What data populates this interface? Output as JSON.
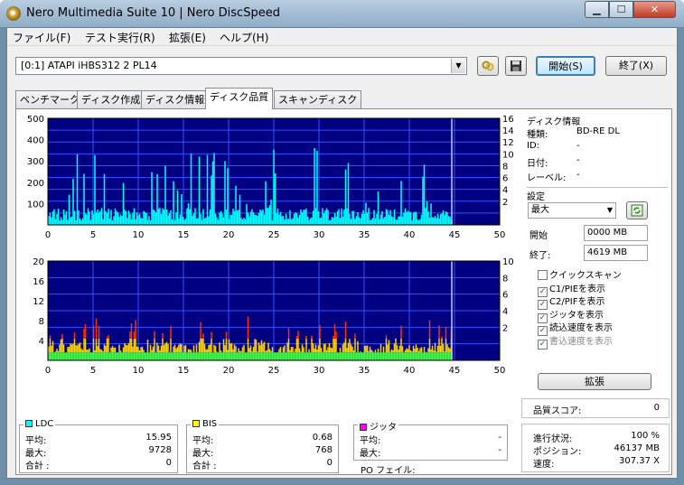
{
  "window": {
    "title": "Nero Multimedia Suite 10 | Nero DiscSpeed"
  },
  "menu": [
    "ファイル(F)",
    "テスト実行(R)",
    "拡張(E)",
    "ヘルプ(H)"
  ],
  "toolbar": {
    "drive": "[0:1]   ATAPI iHBS312   2 PL14",
    "start_label": "開始(S)",
    "exit_label": "終了(X)"
  },
  "tabs": [
    "ベンチマーク",
    "ディスク作成",
    "ディスク情報",
    "ディスク品質",
    "スキャンディスク"
  ],
  "active_tab": 3,
  "chart_data": [
    {
      "type": "bar",
      "x_ticks": [
        "0",
        "5",
        "10",
        "15",
        "20",
        "25",
        "30",
        "35",
        "40",
        "45",
        "50"
      ],
      "y_left_ticks": [
        "500",
        "400",
        "300",
        "200",
        "100"
      ],
      "y_right_ticks": [
        "16",
        "14",
        "12",
        "10",
        "8",
        "6",
        "4",
        "2"
      ],
      "ylim": [
        0,
        500
      ],
      "xlim": [
        0,
        50
      ],
      "series": [
        {
          "name": "LDC",
          "color": "#00ffff"
        }
      ],
      "data_end_x": 44.7
    },
    {
      "type": "bar",
      "x_ticks": [
        "0",
        "5",
        "10",
        "15",
        "20",
        "25",
        "30",
        "35",
        "40",
        "45",
        "50"
      ],
      "y_left_ticks": [
        "20",
        "16",
        "12",
        "8",
        "4"
      ],
      "y_right_ticks": [
        "10",
        "8",
        "6",
        "4",
        "2"
      ],
      "ylim": [
        0,
        20
      ],
      "xlim": [
        0,
        50
      ],
      "series": [
        {
          "name": "BIS",
          "color": "#ffff00"
        }
      ],
      "data_end_x": 44.7
    }
  ],
  "stats": {
    "ldc": {
      "label": "LDC",
      "color": "#00ffff",
      "avg_label": "平均:",
      "avg": "15.95",
      "max_label": "最大:",
      "max": "9728",
      "total_label": "合計 :",
      "total": "0"
    },
    "bis": {
      "label": "BIS",
      "color": "#ffff00",
      "avg_label": "平均:",
      "avg": "0.68",
      "max_label": "最大:",
      "max": "768",
      "total_label": "合計 :",
      "total": "0"
    },
    "jitter": {
      "label": "ジッタ",
      "color": "#ff00ff",
      "avg_label": "平均:",
      "avg": "-",
      "max_label": "最大:",
      "max": "-"
    },
    "po_fail": "PO フェイル:"
  },
  "disc_info": {
    "heading": "ディスク情報",
    "type_label": "種類:",
    "type": "BD-RE DL",
    "id_label": "ID:",
    "id": "-",
    "date_label": "日付:",
    "date": "-",
    "label_label": "レーベル:",
    "label": "-"
  },
  "settings": {
    "heading": "設定",
    "speed": "最大",
    "start_label": "開始",
    "start": "0000 MB",
    "end_label": "終了:",
    "end": "4619 MB",
    "checks": [
      {
        "label": "クイックスキャン",
        "checked": false,
        "disabled": false
      },
      {
        "label": "C1/PIEを表示",
        "checked": true,
        "disabled": false
      },
      {
        "label": "C2/PIFを表示",
        "checked": true,
        "disabled": false
      },
      {
        "label": "ジッタを表示",
        "checked": true,
        "disabled": false
      },
      {
        "label": "読込速度を表示",
        "checked": true,
        "disabled": false
      },
      {
        "label": "書込速度を表示",
        "checked": true,
        "disabled": true
      }
    ],
    "expand_label": "拡張"
  },
  "quality": {
    "label": "品質スコア:",
    "value": "0"
  },
  "progress": {
    "label": "進行状況:",
    "value": "100 %",
    "pos_label": "ポジション:",
    "pos": "46137 MB",
    "speed_label": "速度:",
    "speed": "307.37 X"
  }
}
